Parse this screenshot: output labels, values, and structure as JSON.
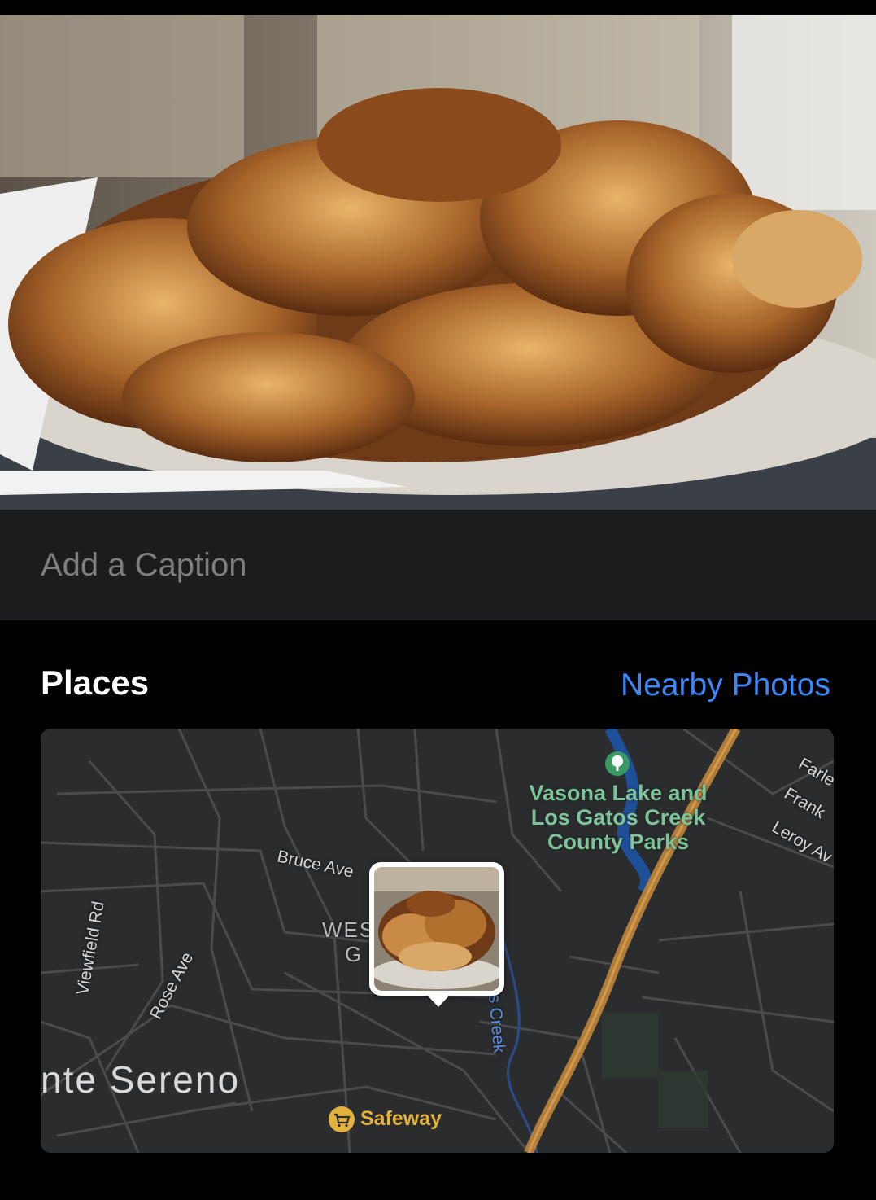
{
  "caption": {
    "placeholder": "Add a Caption"
  },
  "places": {
    "title": "Places",
    "nearby_link": "Nearby Photos"
  },
  "map": {
    "streets": {
      "bruce": "Bruce Ave",
      "viewfield": "Viewfield Rd",
      "rose": "Rose Ave",
      "farley": "Farle",
      "frank": "Frank",
      "leroy": "Leroy Av",
      "creek": "Gatos Creek",
      "west_a": "WES",
      "west_b": "G"
    },
    "park": {
      "line1": "Vasona Lake and",
      "line2": "Los Gatos Creek",
      "line3": "County Parks"
    },
    "city": "nte Sereno",
    "poi": "Safeway",
    "icons": {
      "park": "tree-icon",
      "poi": "shopping-cart-icon"
    }
  },
  "colors": {
    "link": "#3d86f5",
    "caption_bg": "#1c1c1e",
    "map_bg": "#2b2c2e",
    "highway": "#b07e3a",
    "water": "#1e4f99",
    "park_text": "#7ec49a",
    "poi": "#e3b23c"
  }
}
